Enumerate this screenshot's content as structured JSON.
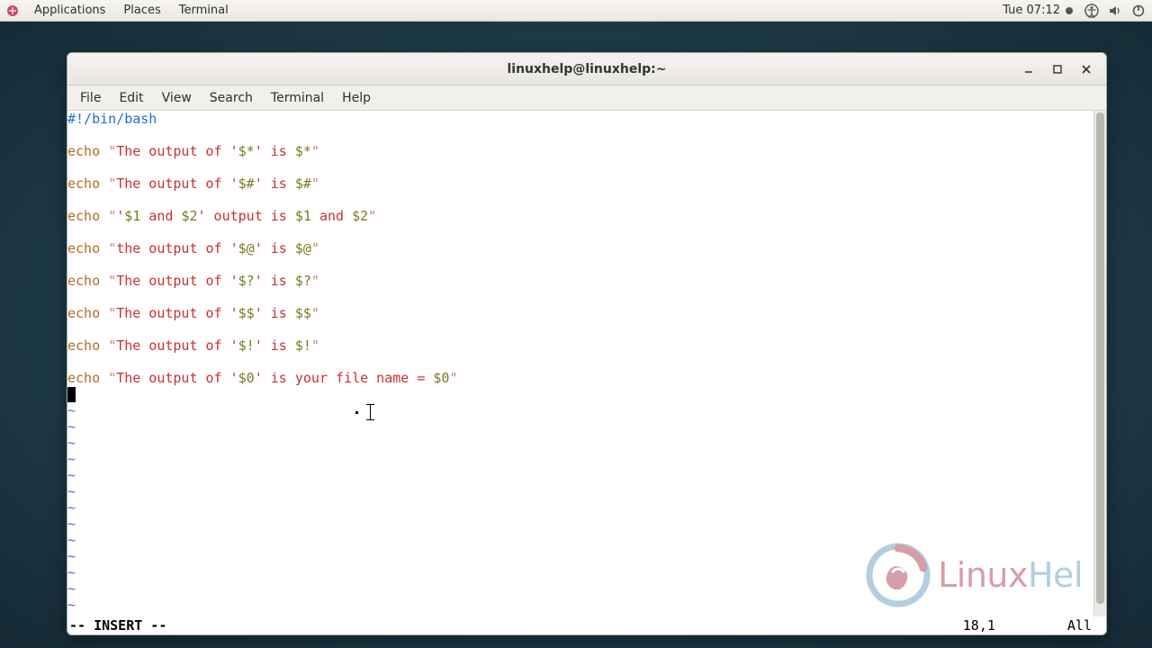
{
  "panel": {
    "applications": "Applications",
    "places": "Places",
    "terminal": "Terminal",
    "clock": "Tue 07:12"
  },
  "window": {
    "title": "linuxhelp@linuxhelp:~"
  },
  "menubar": {
    "file": "File",
    "edit": "Edit",
    "view": "View",
    "search": "Search",
    "terminal": "Terminal",
    "help": "Help"
  },
  "editor": {
    "shebang": "#!/bin/bash",
    "lines": [
      {
        "pre": "The output of '",
        "var": "$*",
        "mid": "' is ",
        "tail": "$*",
        "end": "\""
      },
      {
        "pre": "The output of '",
        "var": "$#",
        "mid": "' is ",
        "tail": "$#",
        "end": "\""
      },
      {
        "custom": true
      },
      {
        "pre": "the output of '",
        "var": "$@",
        "mid": "' is ",
        "tail": "$@",
        "end": "\""
      },
      {
        "pre": "The output of '",
        "var": "$?",
        "mid": "' is ",
        "tail": "$?",
        "end": "\""
      },
      {
        "pre": "The output of '",
        "var": "$$",
        "mid": "' is ",
        "tail": "$$",
        "end": "\""
      },
      {
        "pre": "The output of '",
        "var": "$!",
        "mid": "' is ",
        "tail": "$!",
        "end": "\""
      },
      {
        "pre": "The output of '",
        "var": "$0",
        "mid": "' is your file name = ",
        "tail": "$0",
        "end": "\""
      }
    ],
    "line3": {
      "echo": "echo",
      "q1": " \"'",
      "v1": "$1",
      "and1": " and ",
      "v2": "$2",
      "q2": "'",
      "mid": " output is ",
      "v3": "$1",
      "and2": " and ",
      "v4": "$2",
      "end": "\""
    },
    "tilde": "~"
  },
  "status": {
    "mode": "-- INSERT --",
    "pos": "18,1",
    "scope": "All"
  },
  "watermark": {
    "text_prefix": "Linux",
    "text_suffix": "Hel"
  }
}
